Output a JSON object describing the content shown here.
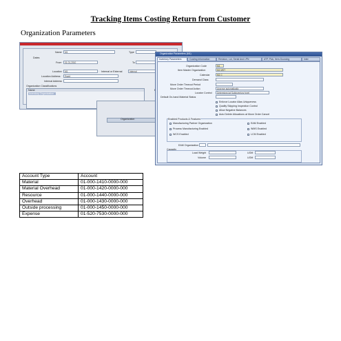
{
  "title": "Tracking Items Costing Return from Customer",
  "section_heading": "Organization Parameters",
  "back_form": {
    "name_label": "Name",
    "name_value": "M1",
    "type_label": "Type",
    "dates_label": "Dates",
    "from_label": "From",
    "from_value": "01-01-2010",
    "to_label": "To",
    "location_label": "Location",
    "location_value": "M1",
    "internal_external_label": "Internal or External",
    "internal_external_value": "Internal",
    "location_address_label": "Location Address",
    "location_address_value": "Egypt",
    "internal_address_label": "Internal Address",
    "org_class_label": "Organization Classifications",
    "list_header": "Name",
    "list_row": "Inventory Organization",
    "en_label": "En",
    "org_button": "Organization"
  },
  "front_window": {
    "title": "Organization Parameters (M1)",
    "tabs": [
      "Inventory Parameters",
      "Costing Information",
      "Revision, Lot, Serial And LPN",
      "ATP, Pick, Item-Sourcing",
      "Inter"
    ],
    "fields": {
      "organization_code_label": "Organization Code",
      "organization_code_value": "M1",
      "item_master_label": "Item Master Organization",
      "item_master_value": "M1 MST",
      "calendar_label": "Calendar",
      "calendar_value": "M1 C",
      "demand_class_label": "Demand Class",
      "move_order_timeout_period_label": "Move Order Timeout Period",
      "move_order_timeout_action_label": "Move Order Timeout Action",
      "move_order_timeout_action_value": "Approve automatically",
      "locator_control_label": "Locator Control",
      "locator_control_value": "Determined at Subinventory level",
      "default_onhand_label": "Default On-hand Material Status"
    },
    "checkboxes": [
      "Enforce Locator Alias Uniqueness",
      "Quality Skipping Inspection Control",
      "Allow Negative Balances",
      "Auto Delete Allocations at Move Order Cancel"
    ],
    "enabled_products_label": "Enabled Products & Features",
    "products_left": [
      "Manufacturing Partner Organization",
      "Process Manufacturing Enabled",
      "WCS Enabled"
    ],
    "products_right": [
      "EAM Enabled",
      "WMS Enabled",
      "LCM Enabled"
    ],
    "eam_org_label": "EAM Organization",
    "capacity_label": "Capacity",
    "load_weight_label": "Load Weight",
    "volume_label": "Volume",
    "uom_label": "UOM"
  },
  "account_table": {
    "headers": [
      "Account Type",
      "Account"
    ],
    "rows": [
      [
        "Material",
        "01-000-1410-0000-000"
      ],
      [
        "Material Overhead",
        "01-000-1420-0000-000"
      ],
      [
        "Resource",
        "01-000-1440-0000-000"
      ],
      [
        "Overhead",
        "01-000-1430-0000-000"
      ],
      [
        "Outside processing",
        "01-000-1450-0000-000"
      ],
      [
        "Expense",
        "01-520-7530-0000-000"
      ]
    ]
  },
  "colors": {
    "title_bar_blue": "#2b4f8f",
    "back_title_red": "#c8282d",
    "required_field": "#f6f0c4"
  }
}
